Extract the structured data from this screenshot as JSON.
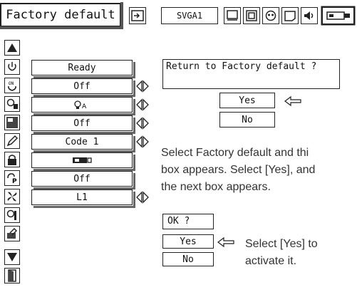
{
  "toolbar": {
    "title": "Factory default",
    "signal": "SVGA1",
    "icons": [
      "input-icon",
      "screen-mode-icon",
      "keystone-icon",
      "image-icon",
      "display-icon",
      "sound-icon",
      "setting-icon"
    ]
  },
  "menu": {
    "rows": [
      {
        "icon": "power-icon",
        "value": "Ready",
        "has_arrows": false
      },
      {
        "icon": "on-start-icon",
        "value": "Off",
        "has_arrows": true
      },
      {
        "icon": "lamp-control-icon",
        "value": "",
        "has_arrows": true
      },
      {
        "icon": "remote-icon",
        "value": "Off",
        "has_arrows": true
      },
      {
        "icon": "pen-code-icon",
        "value": "Code 1",
        "has_arrows": true
      },
      {
        "icon": "lock-icon",
        "value": "",
        "has_arrows": false
      },
      {
        "icon": "pin-lock-icon",
        "value": "Off",
        "has_arrows": false
      },
      {
        "icon": "fan-icon",
        "value": "L1",
        "has_arrows": true
      },
      {
        "icon": "lamp-counter-icon"
      },
      {
        "icon": "factory-default-icon"
      }
    ]
  },
  "dialog1": {
    "message": "Return to Factory default ?",
    "yes_label": "Yes",
    "no_label": "No"
  },
  "dialog2": {
    "message": "OK ?",
    "yes_label": "Yes",
    "no_label": "No"
  },
  "instructions": {
    "line1": "Select Factory default and thi",
    "line2": "box appears. Select [Yes], and",
    "line3": "the next box appears.",
    "step2_line1": "Select [Yes] to",
    "step2_line2": "activate it."
  }
}
